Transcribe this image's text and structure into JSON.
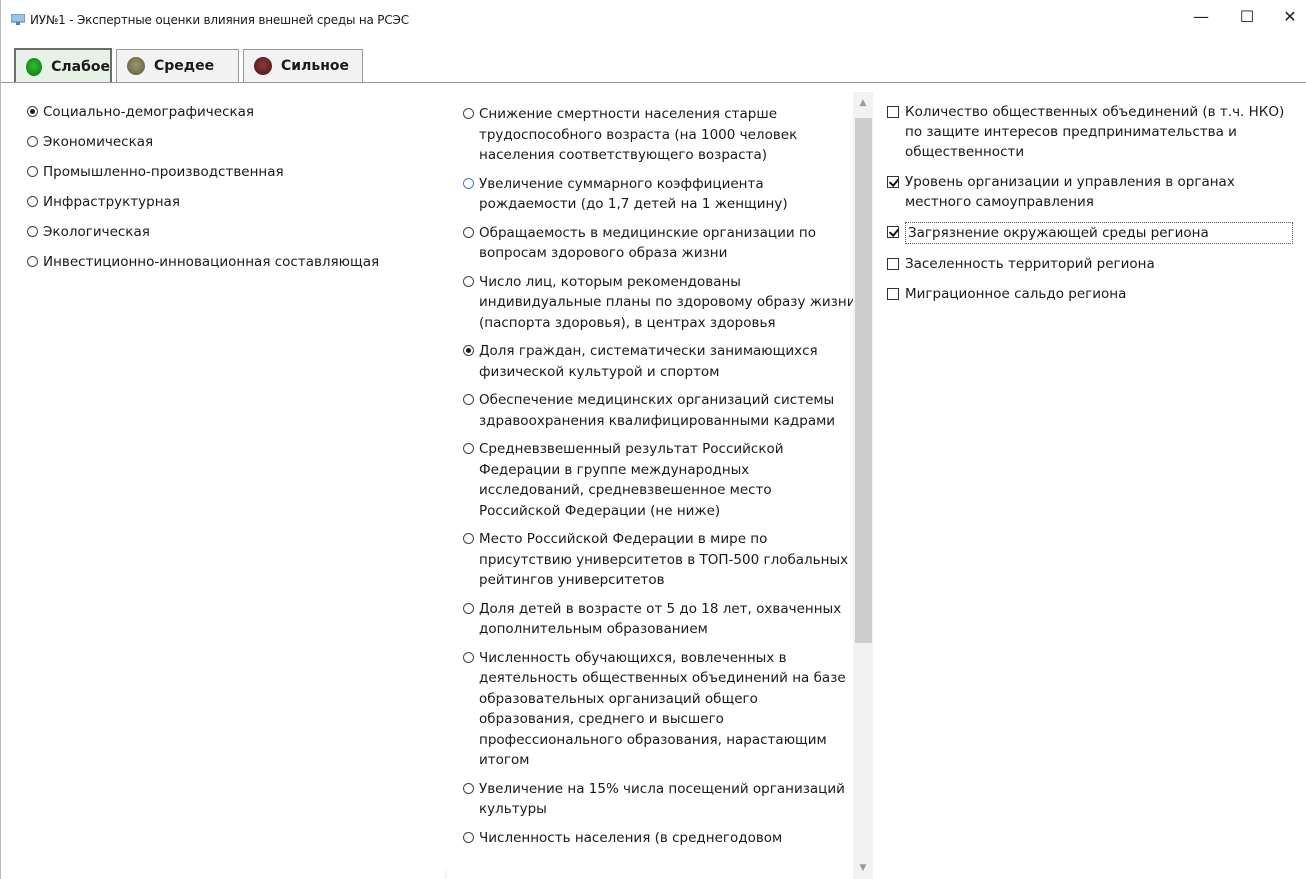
{
  "window": {
    "title": "ИУ№1 - Экспертные оценки влияния внешней среды на РСЭС",
    "controls": {
      "minimize": "—",
      "maximize": "☐",
      "close": "✕"
    }
  },
  "tabs": [
    {
      "label": "Слабое",
      "dot_color": "#1f8c1f",
      "active": true
    },
    {
      "label": "Средее",
      "dot_color": "#7c7a52",
      "active": false
    },
    {
      "label": "Сильное",
      "dot_color": "#6b2a2a",
      "active": false
    }
  ],
  "categories": [
    {
      "label": "Социально-демографическая",
      "checked": true
    },
    {
      "label": "Экономическая",
      "checked": false
    },
    {
      "label": "Промышленно-производственная",
      "checked": false
    },
    {
      "label": "Инфраструктурная",
      "checked": false
    },
    {
      "label": "Экологическая",
      "checked": false
    },
    {
      "label": "Инвестиционно-инновационная составляющая",
      "checked": false
    }
  ],
  "indicators": [
    {
      "label": "Снижение смертности населения старше трудоспособного возраста (на 1000 человек населения соответствующего возраста)",
      "checked": false
    },
    {
      "label": "Увеличение суммарного коэффициента рождаемости (до 1,7 детей на 1 женщину)",
      "checked": false
    },
    {
      "label": "Обращаемость в медицинские организации по вопросам здорового образа жизни",
      "checked": false
    },
    {
      "label": "Число лиц, которым рекомендованы индивидуальные планы по здоровому образу жизни (паспорта здоровья), в центрах здоровья",
      "checked": false
    },
    {
      "label": "Доля граждан, систематически занимающихся физической культурой и спортом",
      "checked": true
    },
    {
      "label": "Обеспечение медицинских организаций системы здравоохранения квалифицированными кадрами",
      "checked": false
    },
    {
      "label": "Средневзвешенный результат Российской Федерации в группе международных исследований, средневзвешенное место Российской Федерации (не ниже)",
      "checked": false
    },
    {
      "label": "Место Российской Федерации в мире по присутствию университетов в ТОП-500 глобальных рейтингов университетов",
      "checked": false
    },
    {
      "label": "Доля детей в возрасте от 5 до 18 лет, охваченных дополнительным образованием",
      "checked": false
    },
    {
      "label": "Численность обучающихся, вовлеченных в деятельность общественных объединений на базе образовательных организаций общего образования, среднего и высшего профессионального образования, нарастающим итогом",
      "checked": false
    },
    {
      "label": "Увеличение на 15% числа посещений организаций культуры",
      "checked": false
    },
    {
      "label": "Численность населения (в среднегодовом",
      "checked": false
    }
  ],
  "factors": [
    {
      "label": "Количество общественных объединений (в т.ч. НКО) по защите интересов предпринимательства и общественности",
      "checked": false
    },
    {
      "label": "Уровень организации и управления в органах местного самоуправления",
      "checked": true
    },
    {
      "label": "Загрязнение окружающей среды региона",
      "checked": true
    },
    {
      "label": "Заселенность территорий региона",
      "checked": false
    },
    {
      "label": "Миграционное сальдо региона",
      "checked": false
    }
  ],
  "scrollbar": {
    "up_icon": "chevron-up-icon",
    "down_icon": "chevron-down-icon"
  }
}
